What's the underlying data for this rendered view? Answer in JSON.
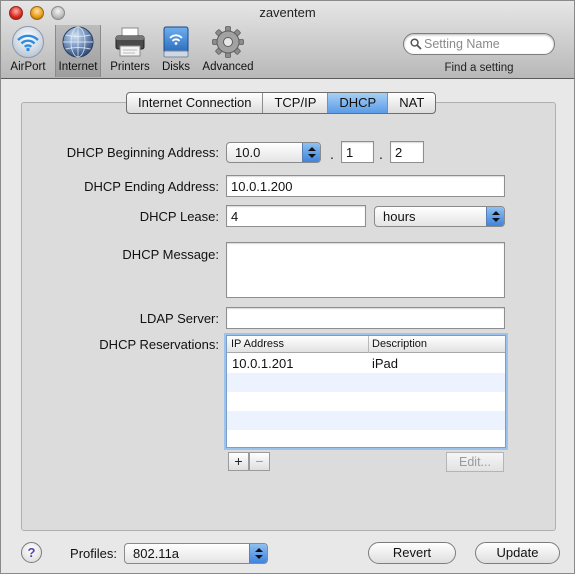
{
  "window": {
    "title": "zaventem"
  },
  "toolbar": {
    "items": [
      {
        "label": "AirPort",
        "icon": "airport-icon"
      },
      {
        "label": "Internet",
        "icon": "internet-globe-icon",
        "selected": true
      },
      {
        "label": "Printers",
        "icon": "printer-icon"
      },
      {
        "label": "Disks",
        "icon": "disk-icon"
      },
      {
        "label": "Advanced",
        "icon": "gear-icon"
      }
    ],
    "search": {
      "placeholder": "Setting Name",
      "value": "",
      "icon": "search-icon"
    },
    "find_label": "Find a setting"
  },
  "tabs": [
    {
      "label": "Internet Connection"
    },
    {
      "label": "TCP/IP"
    },
    {
      "label": "DHCP",
      "active": true
    },
    {
      "label": "NAT"
    }
  ],
  "form": {
    "begin_label": "DHCP Beginning Address:",
    "begin_prefix": "10.0",
    "dot": ".",
    "begin_octet3": "1",
    "begin_octet4": "2",
    "end_label": "DHCP Ending Address:",
    "end_value": "10.0.1.200",
    "lease_label": "DHCP Lease:",
    "lease_value": "4",
    "lease_unit": "hours",
    "message_label": "DHCP Message:",
    "message_value": "",
    "ldap_label": "LDAP Server:",
    "ldap_value": "",
    "reservations_label": "DHCP Reservations:"
  },
  "reservations": {
    "columns": [
      "IP Address",
      "Description"
    ],
    "rows": [
      {
        "ip": "10.0.1.201",
        "description": "iPad"
      }
    ],
    "add_label": "+",
    "remove_label": "−",
    "edit_label": "Edit..."
  },
  "footer": {
    "help_label": "?",
    "profiles_label": "Profiles:",
    "profile_value": "802.11a",
    "revert_label": "Revert",
    "update_label": "Update"
  },
  "colors": {
    "accent_blue": "#5a9be6",
    "close": "#d8281e",
    "minimize": "#e89a17",
    "zoom": "#bcbcbc",
    "table_alt_row": "#edf3fe"
  }
}
